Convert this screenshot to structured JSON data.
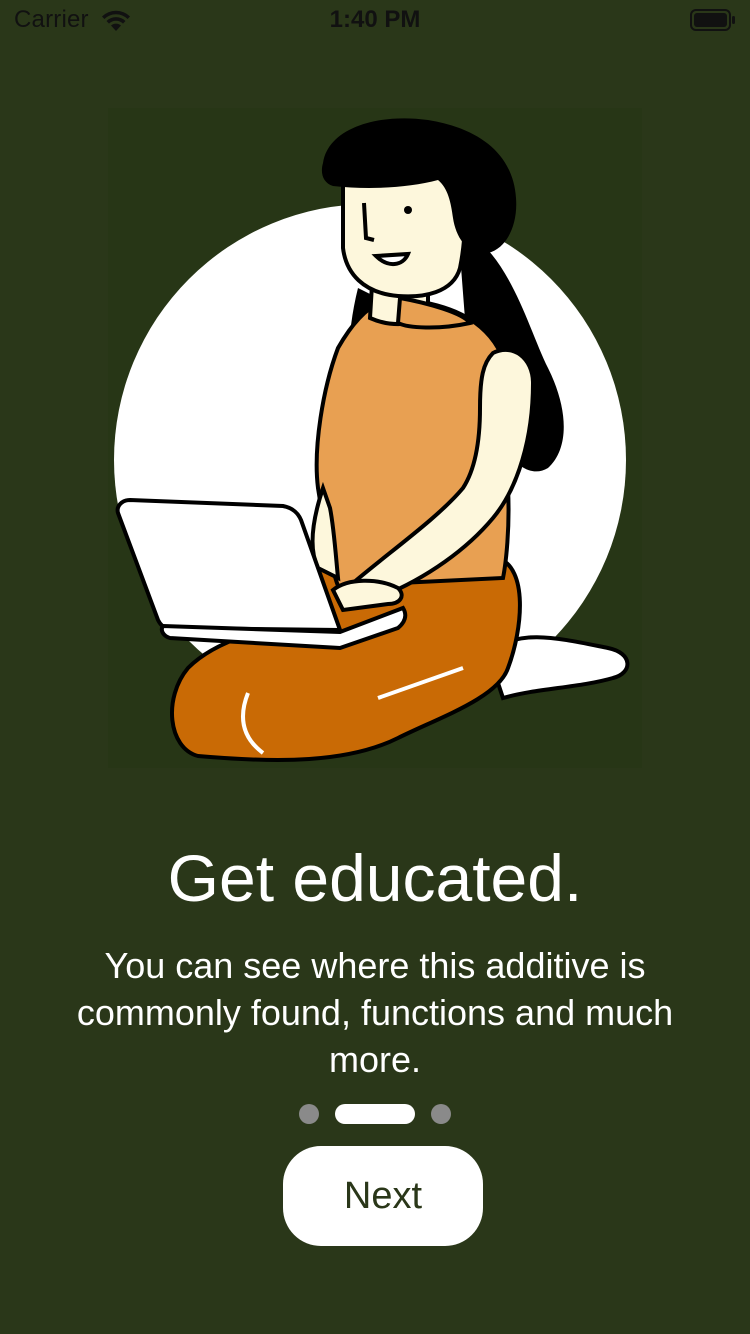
{
  "status_bar": {
    "carrier": "Carrier",
    "time": "1:40 PM",
    "icons": [
      "wifi-icon",
      "battery-icon"
    ]
  },
  "onboarding": {
    "illustration": "woman-with-laptop-illustration",
    "title": "Get educated.",
    "description": "You can see where this additive is commonly found, functions and much more.",
    "pages": {
      "count": 3,
      "active_index": 1
    },
    "next_label": "Next"
  },
  "colors": {
    "background": "#2a3719",
    "button_background": "#ffffff",
    "button_text": "#2a3719",
    "active_dot": "#ffffff",
    "inactive_dot": "#8a8a8a",
    "shirt": "#e8a052",
    "pants": "#c96a05",
    "skin": "#fdf7dc"
  }
}
